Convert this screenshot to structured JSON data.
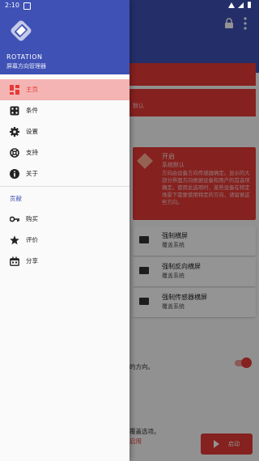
{
  "status_bar": {
    "time": "2:10"
  },
  "drawer": {
    "app_name": "ROTATION",
    "app_subtitle": "屏幕方向管理器",
    "items": [
      {
        "label": "主页",
        "icon": "dashboard-icon",
        "active": true
      },
      {
        "label": "条件",
        "icon": "conditions-icon",
        "active": false
      },
      {
        "label": "设置",
        "icon": "gear-icon",
        "active": false
      },
      {
        "label": "支持",
        "icon": "lifebuoy-icon",
        "active": false
      },
      {
        "label": "关于",
        "icon": "info-icon",
        "active": false
      }
    ],
    "section_title": "贡献",
    "contrib_items": [
      {
        "label": "购买",
        "icon": "key-icon"
      },
      {
        "label": "评价",
        "icon": "star-icon"
      },
      {
        "label": "分享",
        "icon": "share-icon"
      }
    ]
  },
  "background": {
    "strip_text": "默认",
    "card_title": "开启",
    "card_subtitle": "系统默认",
    "card_description": "方向由设备方向传感器确定。显示的大部分界面方向根据设备和用户的首选项确定。使用此选项时，某些设备在特定场景下需要使用特定的方向，请留意这些方向。",
    "options": [
      {
        "title": "强制横屏",
        "subtitle": "覆盖系统"
      },
      {
        "title": "强制反向横屏",
        "subtitle": "覆盖系统"
      },
      {
        "title": "强制传感器横屏",
        "subtitle": "覆盖系统"
      }
    ],
    "toggle_text": "的方向。",
    "bottom_text_1": "覆盖选项。",
    "bottom_text_2": "启用",
    "fab_label": "启动"
  },
  "colors": {
    "primary": "#3f51b5",
    "accent": "#e53935",
    "active_bg": "#f4b4b4",
    "section": "#3f51b5"
  }
}
